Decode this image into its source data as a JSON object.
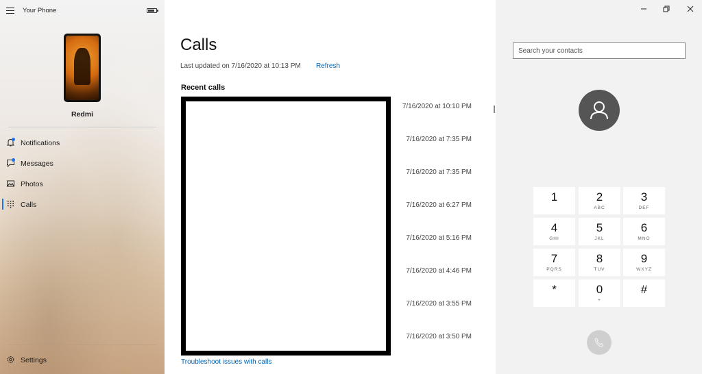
{
  "app": {
    "title": "Your Phone"
  },
  "device": {
    "name": "Redmi"
  },
  "nav": {
    "notifications": "Notifications",
    "messages": "Messages",
    "photos": "Photos",
    "calls": "Calls",
    "settings": "Settings"
  },
  "main": {
    "title": "Calls",
    "last_updated": "Last updated on 7/16/2020 at 10:13 PM",
    "refresh": "Refresh",
    "recent_calls": "Recent calls",
    "troubleshoot": "Troubleshoot issues with calls",
    "calls": [
      "7/16/2020 at 10:10 PM",
      "7/16/2020 at 7:35 PM",
      "7/16/2020 at 7:35 PM",
      "7/16/2020 at 6:27 PM",
      "7/16/2020 at 5:16 PM",
      "7/16/2020 at 4:46 PM",
      "7/16/2020 at 3:55 PM",
      "7/16/2020 at 3:50 PM"
    ]
  },
  "dialer": {
    "search_placeholder": "Search your contacts",
    "keys": [
      {
        "digit": "1",
        "letters": ""
      },
      {
        "digit": "2",
        "letters": "ABC"
      },
      {
        "digit": "3",
        "letters": "DEF"
      },
      {
        "digit": "4",
        "letters": "GHI"
      },
      {
        "digit": "5",
        "letters": "JKL"
      },
      {
        "digit": "6",
        "letters": "MNO"
      },
      {
        "digit": "7",
        "letters": "PQRS"
      },
      {
        "digit": "8",
        "letters": "TUV"
      },
      {
        "digit": "9",
        "letters": "WXYZ"
      },
      {
        "digit": "*",
        "letters": ""
      },
      {
        "digit": "0",
        "letters": "+"
      },
      {
        "digit": "#",
        "letters": ""
      }
    ]
  },
  "icons": {
    "menu": "hamburger-icon",
    "battery": "battery-icon",
    "notifications": "bell-icon",
    "messages": "chat-icon",
    "photos": "image-icon",
    "calls": "keypad-icon",
    "settings": "gear-icon",
    "minimize": "minimize-icon",
    "restore": "restore-icon",
    "close": "close-icon",
    "avatar": "person-icon",
    "call": "phone-icon"
  },
  "colors": {
    "accent": "#0063b1",
    "badge": "#1a73e8",
    "avatar_bg": "#555555"
  }
}
